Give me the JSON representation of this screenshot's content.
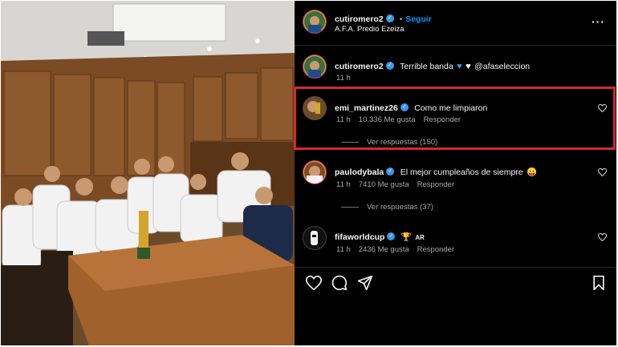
{
  "header": {
    "username": "cutiromero2",
    "separator": "•",
    "follow_label": "Seguir",
    "location": "A.F.A. Predio Ezeiza",
    "more_icon": "more-dots-icon"
  },
  "caption": {
    "username": "cutiromero2",
    "text_before": "Terrible banda",
    "text_after": "@afaseleccion",
    "time": "11 h"
  },
  "comments": [
    {
      "username": "emi_martinez26",
      "text": "Como me limpiaron",
      "time": "11 h",
      "likes": "10.336 Me gusta",
      "reply_label": "Responder",
      "replies": "Ver respuestas (150)"
    },
    {
      "username": "paulodybala",
      "text": "El mejor cumpleaños de siempre",
      "emoji": "😛",
      "time": "11 h",
      "likes": "7410 Me gusta",
      "reply_label": "Responder",
      "replies": "Ver respuestas (37)"
    },
    {
      "username": "fifaworldcup",
      "text": "🏆",
      "flag": "AR",
      "time": "11 h",
      "likes": "2436 Me gusta",
      "reply_label": "Responder"
    }
  ],
  "actions": {
    "like_icon": "heart-icon",
    "comment_icon": "comment-icon",
    "share_icon": "share-icon",
    "save_icon": "bookmark-icon"
  },
  "colors": {
    "background": "#000000",
    "link": "#0095f6",
    "verified": "#3897f0",
    "highlight_border": "#d22a2a"
  }
}
